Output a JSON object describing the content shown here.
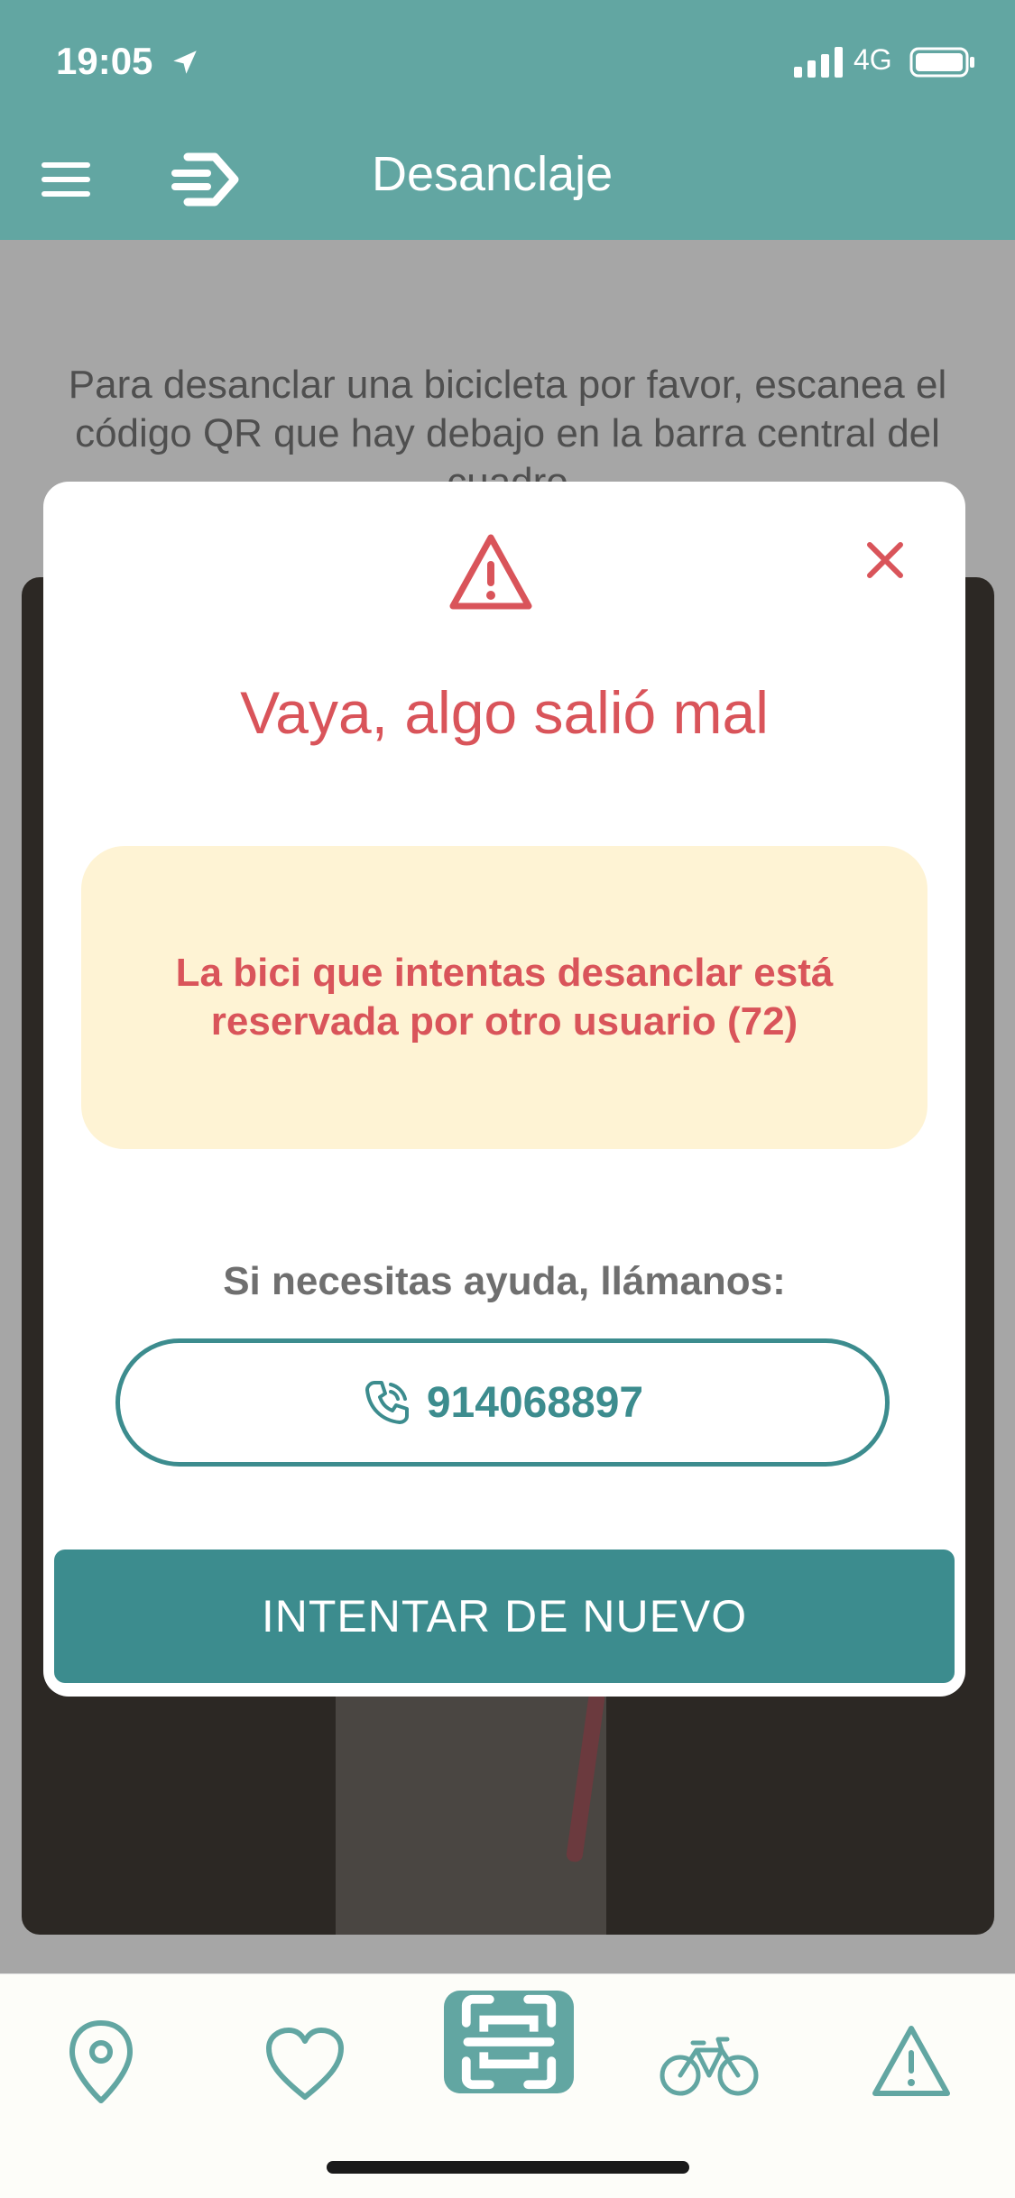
{
  "status_bar": {
    "time": "19:05",
    "network": "4G"
  },
  "header": {
    "title": "Desanclaje"
  },
  "background": {
    "instructions": "Para desanclar una bicicleta por favor, escanea el código QR que hay debajo en la barra central del cuadro"
  },
  "modal": {
    "title": "Vaya, algo salió mal",
    "error_message": "La bici que intentas desanclar está reservada por otro usuario (72)",
    "help_text": "Si necesitas ayuda, llámanos:",
    "phone_number": "914068897",
    "retry_label": "INTENTAR DE NUEVO"
  },
  "tabbar": {
    "items": [
      "map-pin-icon",
      "heart-icon",
      "qr-scan-icon",
      "bike-icon",
      "warning-icon"
    ]
  },
  "colors": {
    "accent": "#3c8c8e",
    "header": "#62a6a2",
    "error": "#d9545a",
    "error_bg": "#fef3d4"
  }
}
